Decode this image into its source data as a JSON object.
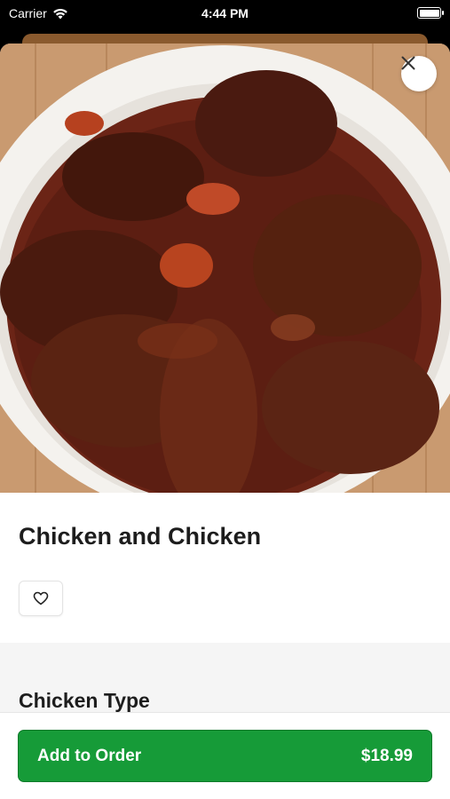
{
  "status_bar": {
    "carrier": "Carrier",
    "time": "4:44 PM"
  },
  "item": {
    "title": "Chicken and Chicken",
    "image": "braised-chicken-stew-photo"
  },
  "options": {
    "section_title": "Chicken Type"
  },
  "order_button": {
    "label": "Add to Order",
    "price": "$18.99"
  },
  "colors": {
    "accent": "#169b38",
    "background": "#ffffff",
    "section_bg": "#f5f5f5"
  },
  "icons": {
    "close": "close-icon",
    "favorite": "heart-icon",
    "wifi": "wifi-icon",
    "battery": "battery-icon"
  }
}
